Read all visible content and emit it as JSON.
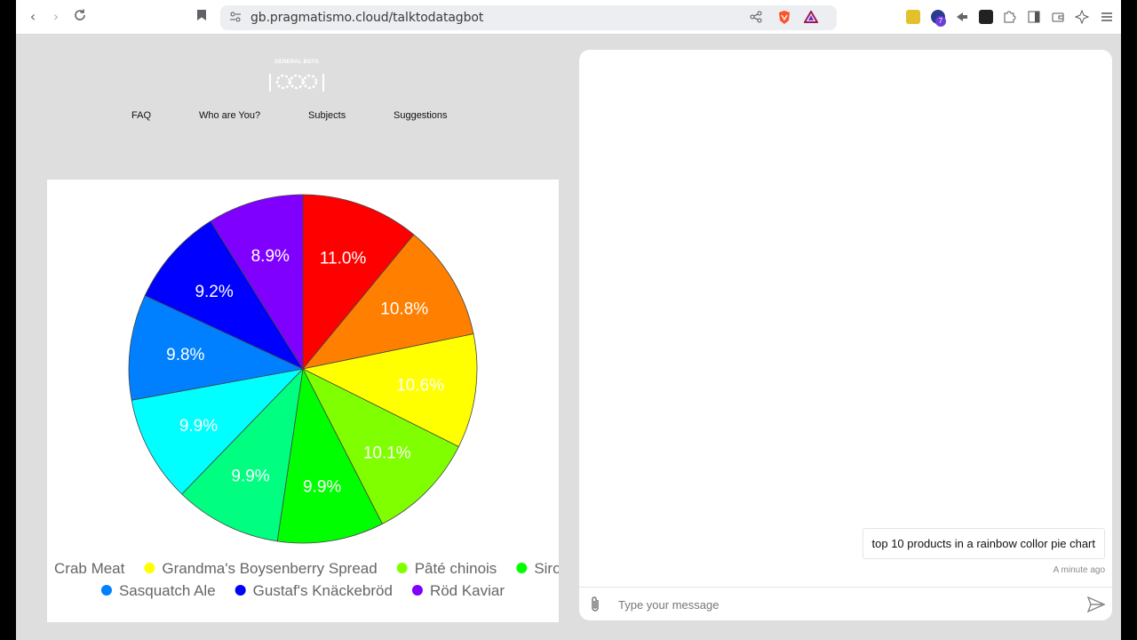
{
  "browser": {
    "url": "gb.pragmatismo.cloud/talktodatagbot",
    "extension_badge": "7"
  },
  "logo": {
    "text": "GENERAL BOTS"
  },
  "nav": [
    "FAQ",
    "Who are You?",
    "Subjects",
    "Suggestions"
  ],
  "chart_data": {
    "type": "pie",
    "title": "",
    "slices": [
      {
        "label": "",
        "value": 11.0,
        "color": "#ff0000"
      },
      {
        "label": "",
        "value": 10.8,
        "color": "#ff8000"
      },
      {
        "label": "",
        "value": 10.6,
        "color": "#ffff00"
      },
      {
        "label": "",
        "value": 10.1,
        "color": "#80ff00"
      },
      {
        "label": "",
        "value": 9.9,
        "color": "#00ff00"
      },
      {
        "label": "",
        "value": 9.9,
        "color": "#00ff80"
      },
      {
        "label": "",
        "value": 9.9,
        "color": "#00ffff"
      },
      {
        "label": "",
        "value": 9.8,
        "color": "#0080ff"
      },
      {
        "label": "",
        "value": 9.2,
        "color": "#0000ff"
      },
      {
        "label": "",
        "value": 8.9,
        "color": "#8000ff"
      }
    ],
    "data_labels": [
      "11.0%",
      "10.8%",
      "10.6%",
      "10.1%",
      "9.9%",
      "9.9%",
      "9.9%",
      "9.8%",
      "9.2%",
      "8.9%"
    ],
    "legend_position": "bottom",
    "legend": [
      {
        "label": "Crab Meat",
        "color": "#00ffff"
      },
      {
        "label": "Grandma's Boysenberry Spread",
        "color": "#ffff00"
      },
      {
        "label": "Pâté chinois",
        "color": "#80ff00"
      },
      {
        "label": "Sirop",
        "color": "#00ff00"
      },
      {
        "label": "Sasquatch Ale",
        "color": "#0080ff"
      },
      {
        "label": "Gustaf's Knäckebröd",
        "color": "#0000ff"
      },
      {
        "label": "Röd Kaviar",
        "color": "#8000ff"
      }
    ]
  },
  "chat": {
    "message": "top 10 products in a rainbow collor pie chart",
    "timestamp": "A minute ago",
    "input_placeholder": "Type your message"
  }
}
